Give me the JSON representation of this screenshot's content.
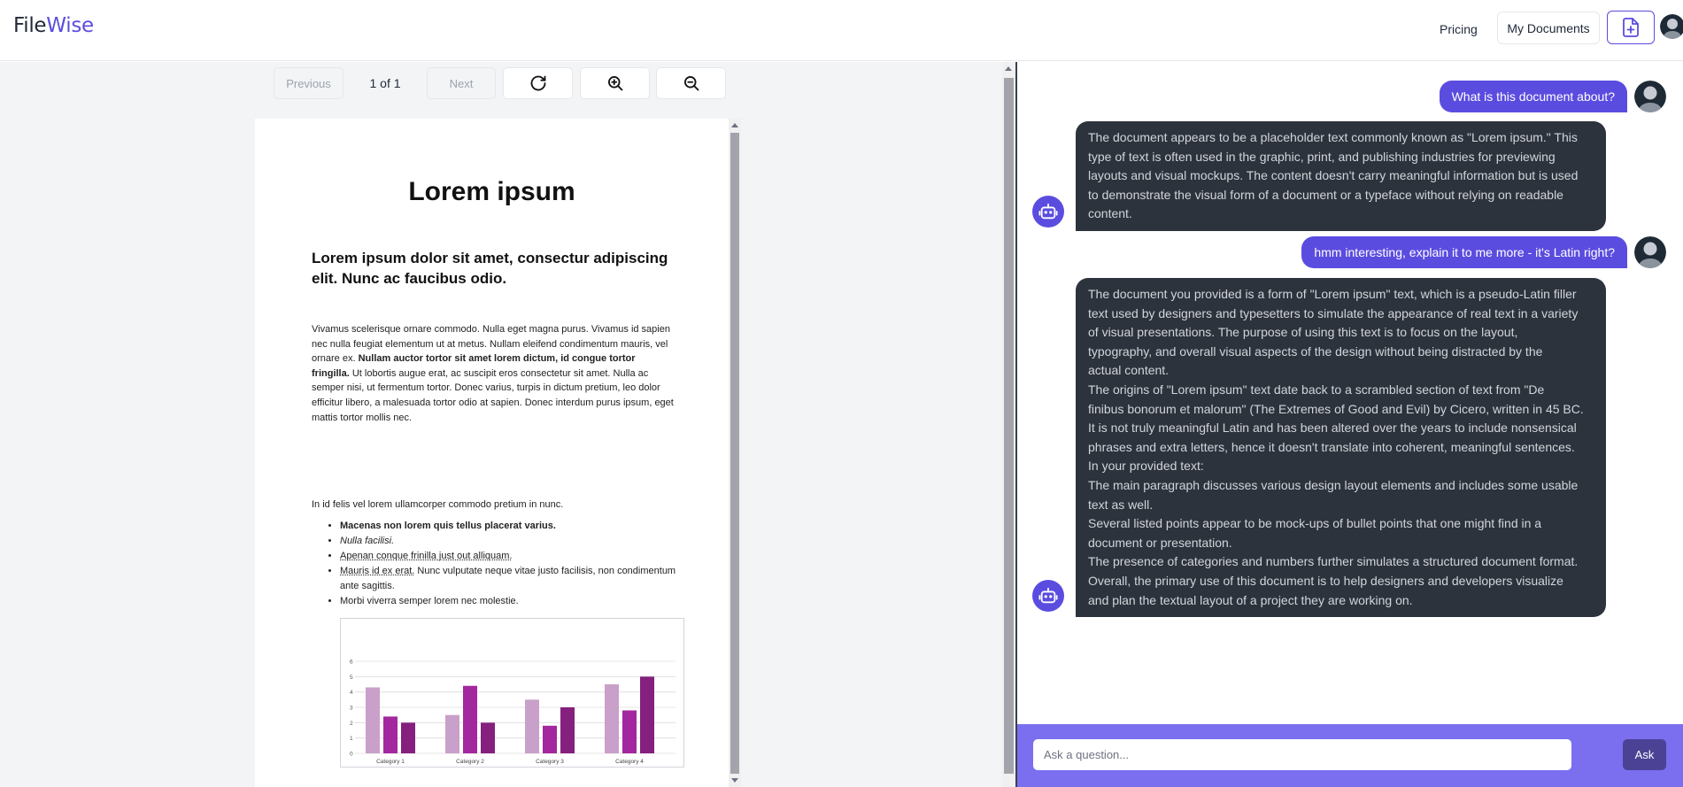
{
  "header": {
    "logo_part1": "File",
    "logo_part2": "Wise",
    "pricing_label": "Pricing",
    "my_documents_label": "My Documents"
  },
  "toolbar": {
    "previous_label": "Previous",
    "page_indicator": "1 of 1",
    "next_label": "Next"
  },
  "document": {
    "title": "Lorem ipsum",
    "subtitle": "Lorem ipsum dolor sit amet, consectur adipiscing elit. Nunc ac faucibus odio.",
    "para_part1": "Vivamus scelerisque ornare commodo. Nulla eget magna purus. Vivamus id sapien nec nulla feugiat elementum ut at metus. Nullam eleifend condimentum mauris, vel ornare ex. ",
    "para_bold": "Nullam auctor tortor sit amet lorem dictum, id congue tortor fringilla.",
    "para_part2": " Ut lobortis augue erat, ac suscipit eros consectetur sit amet. Nulla ac semper nisi, ut fermentum tortor. Donec varius, turpis in dictum pretium, leo dolor efficitur libero, a malesuada tortor odio at sapien. Donec interdum purus ipsum, eget mattis tortor mollis nec.",
    "line2": "In id felis vel lorem ullamcorper commodo pretium in nunc.",
    "list": {
      "item1": "Macenas non lorem quis tellus placerat varius.",
      "item2": "Nulla facilisi.",
      "item3": "Apenan conque frinilla just out alliquam.",
      "item4_underlined": "Mauris id ex erat.",
      "item4_rest": " Nunc vulputate neque vitae justo facilisis, non condimentum ante sagittis.",
      "item5": "Morbi viverra semper lorem nec molestie."
    }
  },
  "chart_data": {
    "type": "bar",
    "categories": [
      "Category 1",
      "Category 2",
      "Category 3",
      "Category 4"
    ],
    "series": [
      {
        "values": [
          4.3,
          2.5,
          3.5,
          4.5
        ],
        "color": "#c9a0c9"
      },
      {
        "values": [
          2.4,
          4.4,
          1.8,
          2.8
        ],
        "color": "#a3279e"
      },
      {
        "values": [
          2.0,
          2.0,
          3.0,
          5.0
        ],
        "color": "#85207e"
      }
    ],
    "y_ticks": [
      "0",
      "1",
      "2",
      "3",
      "4",
      "5",
      "6"
    ],
    "ylim": [
      0,
      6
    ],
    "grid": true
  },
  "chat": {
    "messages": [
      {
        "role": "user",
        "text": "What is this document about?"
      },
      {
        "role": "bot",
        "lines": [
          "The document appears to be a placeholder text commonly known as \"Lorem ipsum.\" This",
          "type of text is often used in the graphic, print, and publishing industries for previewing",
          "layouts and visual mockups. The content doesn't carry meaningful information but is used",
          "to demonstrate the visual form of a document or a typeface without relying on readable",
          "content."
        ]
      },
      {
        "role": "user",
        "text": "hmm interesting, explain it to me more - it's Latin right?"
      },
      {
        "role": "bot",
        "lines": [
          "The document you provided is a form of \"Lorem ipsum\" text, which is a pseudo-Latin filler",
          "text used by designers and typesetters to simulate the appearance of real text in a variety",
          "of visual presentations. The purpose of using this text is to focus on the layout,",
          "typography, and overall visual aspects of the design without being distracted by the",
          "actual content.",
          "The origins of \"Lorem ipsum\" text date back to a scrambled section of text from \"De",
          "finibus bonorum et malorum\" (The Extremes of Good and Evil) by Cicero, written in 45 BC.",
          "It is not truly meaningful Latin and has been altered over the years to include nonsensical",
          "phrases and extra letters, hence it doesn't translate into coherent, meaningful sentences.",
          "In your provided text:",
          "The main paragraph discusses various design layout elements and includes some usable",
          "text as well.",
          "Several listed points appear to be mock-ups of bullet points that one might find in a",
          "document or presentation.",
          "The presence of categories and numbers further simulates a structured document format.",
          "Overall, the primary use of this document is to help designers and developers visualize",
          "and plan the textual layout of a project they are working on."
        ]
      }
    ]
  },
  "input": {
    "placeholder": "Ask a question...",
    "ask_label": "Ask"
  },
  "colors": {
    "accent": "#5b4ce0",
    "bot_bubble": "#2d333c",
    "input_bar": "#7b6ff0",
    "ask_button": "#4b4296"
  },
  "icons": {
    "upload": "file-plus-icon",
    "refresh": "rotate-cw-icon",
    "zoom_in": "zoom-in-icon",
    "zoom_out": "zoom-out-icon",
    "bot": "robot-icon"
  }
}
